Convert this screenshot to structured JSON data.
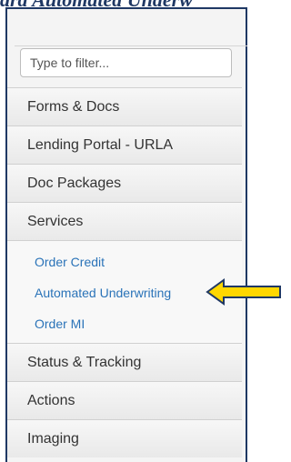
{
  "heading": "ard Automated Underw",
  "filter": {
    "placeholder": "Type to filter..."
  },
  "menu": [
    {
      "label": "Forms & Docs"
    },
    {
      "label": "Lending Portal - URLA"
    },
    {
      "label": "Doc Packages"
    },
    {
      "label": "Services"
    }
  ],
  "services_submenu": [
    {
      "label": "Order Credit"
    },
    {
      "label": "Automated Underwriting"
    },
    {
      "label": "Order MI"
    }
  ],
  "menu_after": [
    {
      "label": "Status & Tracking"
    },
    {
      "label": "Actions"
    },
    {
      "label": "Imaging"
    }
  ],
  "colors": {
    "panel_border": "#1f3864",
    "link": "#2a73b8",
    "arrow_fill": "#ffd700",
    "arrow_stroke": "#1f3864"
  },
  "annotation": {
    "icon": "left-arrow-icon"
  }
}
